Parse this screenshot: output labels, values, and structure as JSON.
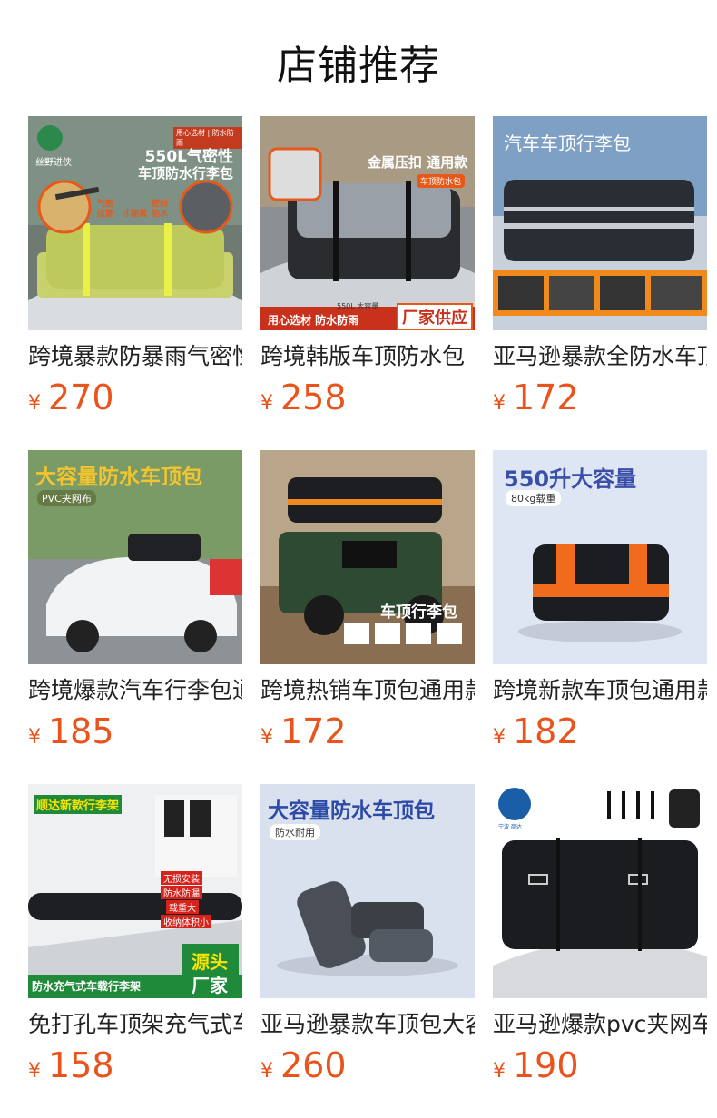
{
  "page_title": "店铺推荐",
  "currency_symbol": "¥",
  "products": [
    {
      "name": "跨境暴款防暴雨气密性车顶防水行李包",
      "price": "270",
      "thumb": {
        "headline": "550L气密性",
        "sub": "车顶防水行李包",
        "badge": "用心选材 | 防水防雨",
        "tag1": "气密拉链",
        "tag2": "才能真",
        "tag3": "密封防水",
        "brand": "丝野进侠"
      }
    },
    {
      "name": "跨境韩版车顶防水包",
      "price": "258",
      "thumb": {
        "headline": "金属压扣 通用款",
        "sub": "车顶防水包",
        "banner": "用心选材 防水防雨",
        "badge": "厂家供应",
        "cap": "550L 大容量"
      }
    },
    {
      "name": "亚马逊暴款全防水车顶包",
      "price": "172",
      "thumb": {
        "headline": "汽车车顶行李包"
      }
    },
    {
      "name": "跨境爆款汽车行李包通用",
      "price": "185",
      "thumb": {
        "headline": "大容量防水车顶包",
        "sub": "PVC夹网布"
      }
    },
    {
      "name": "跨境热销车顶包通用款",
      "price": "172",
      "thumb": {
        "headline": "车顶行李包"
      }
    },
    {
      "name": "跨境新款车顶包通用款",
      "price": "182",
      "thumb": {
        "headline": "550升大容量",
        "sub": "80kg载重"
      }
    },
    {
      "name": "免打孔车顶架充气式车顶",
      "price": "158",
      "thumb": {
        "headline": "顺达新款行李架",
        "f1": "无损安装",
        "f2": "防水防漏",
        "f3": "载重大",
        "f4": "收纳体积小",
        "banner": "防水充气式车载行李架",
        "badge1": "源头",
        "badge2": "厂家"
      }
    },
    {
      "name": "亚马逊暴款车顶包大容量",
      "price": "260",
      "thumb": {
        "headline": "大容量防水车顶包",
        "sub": "防水耐用"
      }
    },
    {
      "name": "亚马逊爆款pvc夹网车顶包",
      "price": "190",
      "thumb": {
        "logo": "宁波 商达"
      }
    }
  ],
  "colors": {
    "price": "#e8541b",
    "title": "#111111"
  }
}
